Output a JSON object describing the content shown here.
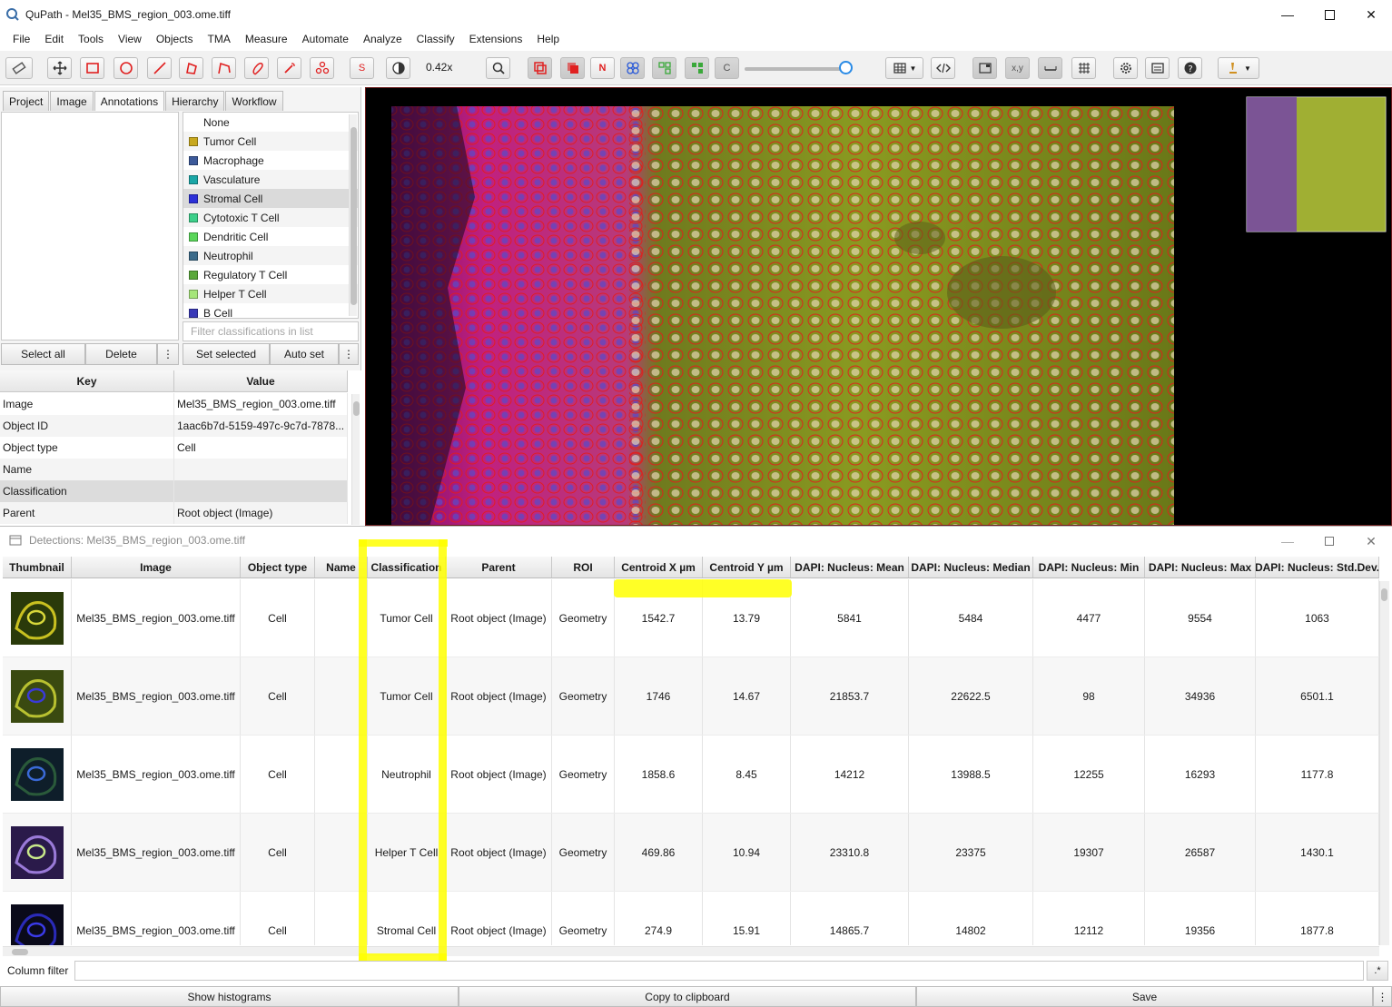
{
  "window": {
    "title": "QuPath - Mel35_BMS_region_003.ome.tiff"
  },
  "menu": [
    "File",
    "Edit",
    "Tools",
    "View",
    "Objects",
    "TMA",
    "Measure",
    "Automate",
    "Analyze",
    "Classify",
    "Extensions",
    "Help"
  ],
  "toolbar": {
    "zoom": "0.42x",
    "s_label": "S",
    "n_label": "N",
    "c_label": "C",
    "xy_label": "x,y"
  },
  "left": {
    "tabs": [
      "Project",
      "Image",
      "Annotations",
      "Hierarchy",
      "Workflow"
    ],
    "active_tab": "Annotations",
    "classes": [
      {
        "name": "None",
        "color": "#ffffff"
      },
      {
        "name": "Tumor Cell",
        "color": "#c8a81e"
      },
      {
        "name": "Macrophage",
        "color": "#3c5a9a"
      },
      {
        "name": "Vasculature",
        "color": "#1aa6a6"
      },
      {
        "name": "Stromal Cell",
        "color": "#2c30d8"
      },
      {
        "name": "Cytotoxic T Cell",
        "color": "#3ccf8a"
      },
      {
        "name": "Dendritic Cell",
        "color": "#5ad65a"
      },
      {
        "name": "Neutrophil",
        "color": "#3a6a8a"
      },
      {
        "name": "Regulatory T Cell",
        "color": "#5aa83a"
      },
      {
        "name": "Helper T Cell",
        "color": "#a6e67a"
      },
      {
        "name": "B Cell",
        "color": "#3a3ab8"
      }
    ],
    "selected_class": "Stromal Cell",
    "class_filter_placeholder": "Filter classifications in list",
    "buttons": {
      "select_all": "Select all",
      "delete": "Delete",
      "set_selected": "Set selected",
      "auto_set": "Auto set",
      "more": "⋮"
    },
    "props_header": {
      "key": "Key",
      "value": "Value"
    },
    "props": [
      {
        "key": "Image",
        "value": "Mel35_BMS_region_003.ome.tiff"
      },
      {
        "key": "Object ID",
        "value": "1aac6b7d-5159-497c-9c7d-7878..."
      },
      {
        "key": "Object type",
        "value": "Cell"
      },
      {
        "key": "Name",
        "value": ""
      },
      {
        "key": "Classification",
        "value": ""
      },
      {
        "key": "Parent",
        "value": "Root object (Image)"
      }
    ]
  },
  "detections": {
    "title": "Detections: Mel35_BMS_region_003.ome.tiff",
    "columns": [
      "Thumbnail",
      "Image",
      "Object type",
      "Name",
      "Classification",
      "Parent",
      "ROI",
      "Centroid X µm",
      "Centroid Y µm",
      "DAPI: Nucleus: Mean",
      "DAPI: Nucleus: Median",
      "DAPI: Nucleus: Min",
      "DAPI: Nucleus: Max",
      "DAPI: Nucleus: Std.Dev."
    ],
    "rows": [
      {
        "image": "Mel35_BMS_region_003.ome.tiff",
        "type": "Cell",
        "name": "",
        "cls": "Tumor Cell",
        "parent": "Root object (Image)",
        "roi": "Geometry",
        "cx": "1542.7",
        "cy": "13.79",
        "mean": "5841",
        "median": "5484",
        "min": "4477",
        "max": "9554",
        "sd": "1063"
      },
      {
        "image": "Mel35_BMS_region_003.ome.tiff",
        "type": "Cell",
        "name": "",
        "cls": "Tumor Cell",
        "parent": "Root object (Image)",
        "roi": "Geometry",
        "cx": "1746",
        "cy": "14.67",
        "mean": "21853.7",
        "median": "22622.5",
        "min": "98",
        "max": "34936",
        "sd": "6501.1"
      },
      {
        "image": "Mel35_BMS_region_003.ome.tiff",
        "type": "Cell",
        "name": "",
        "cls": "Neutrophil",
        "parent": "Root object (Image)",
        "roi": "Geometry",
        "cx": "1858.6",
        "cy": "8.45",
        "mean": "14212",
        "median": "13988.5",
        "min": "12255",
        "max": "16293",
        "sd": "1177.8"
      },
      {
        "image": "Mel35_BMS_region_003.ome.tiff",
        "type": "Cell",
        "name": "",
        "cls": "Helper T Cell",
        "parent": "Root object (Image)",
        "roi": "Geometry",
        "cx": "469.86",
        "cy": "10.94",
        "mean": "23310.8",
        "median": "23375",
        "min": "19307",
        "max": "26587",
        "sd": "1430.1"
      },
      {
        "image": "Mel35_BMS_region_003.ome.tiff",
        "type": "Cell",
        "name": "",
        "cls": "Stromal Cell",
        "parent": "Root object (Image)",
        "roi": "Geometry",
        "cx": "274.9",
        "cy": "15.91",
        "mean": "14865.7",
        "median": "14802",
        "min": "12112",
        "max": "19356",
        "sd": "1877.8"
      }
    ],
    "column_filter_label": "Column filter",
    "regex_label": ".*",
    "buttons": {
      "histograms": "Show histograms",
      "copy": "Copy to clipboard",
      "save": "Save",
      "more": "⋮"
    }
  }
}
